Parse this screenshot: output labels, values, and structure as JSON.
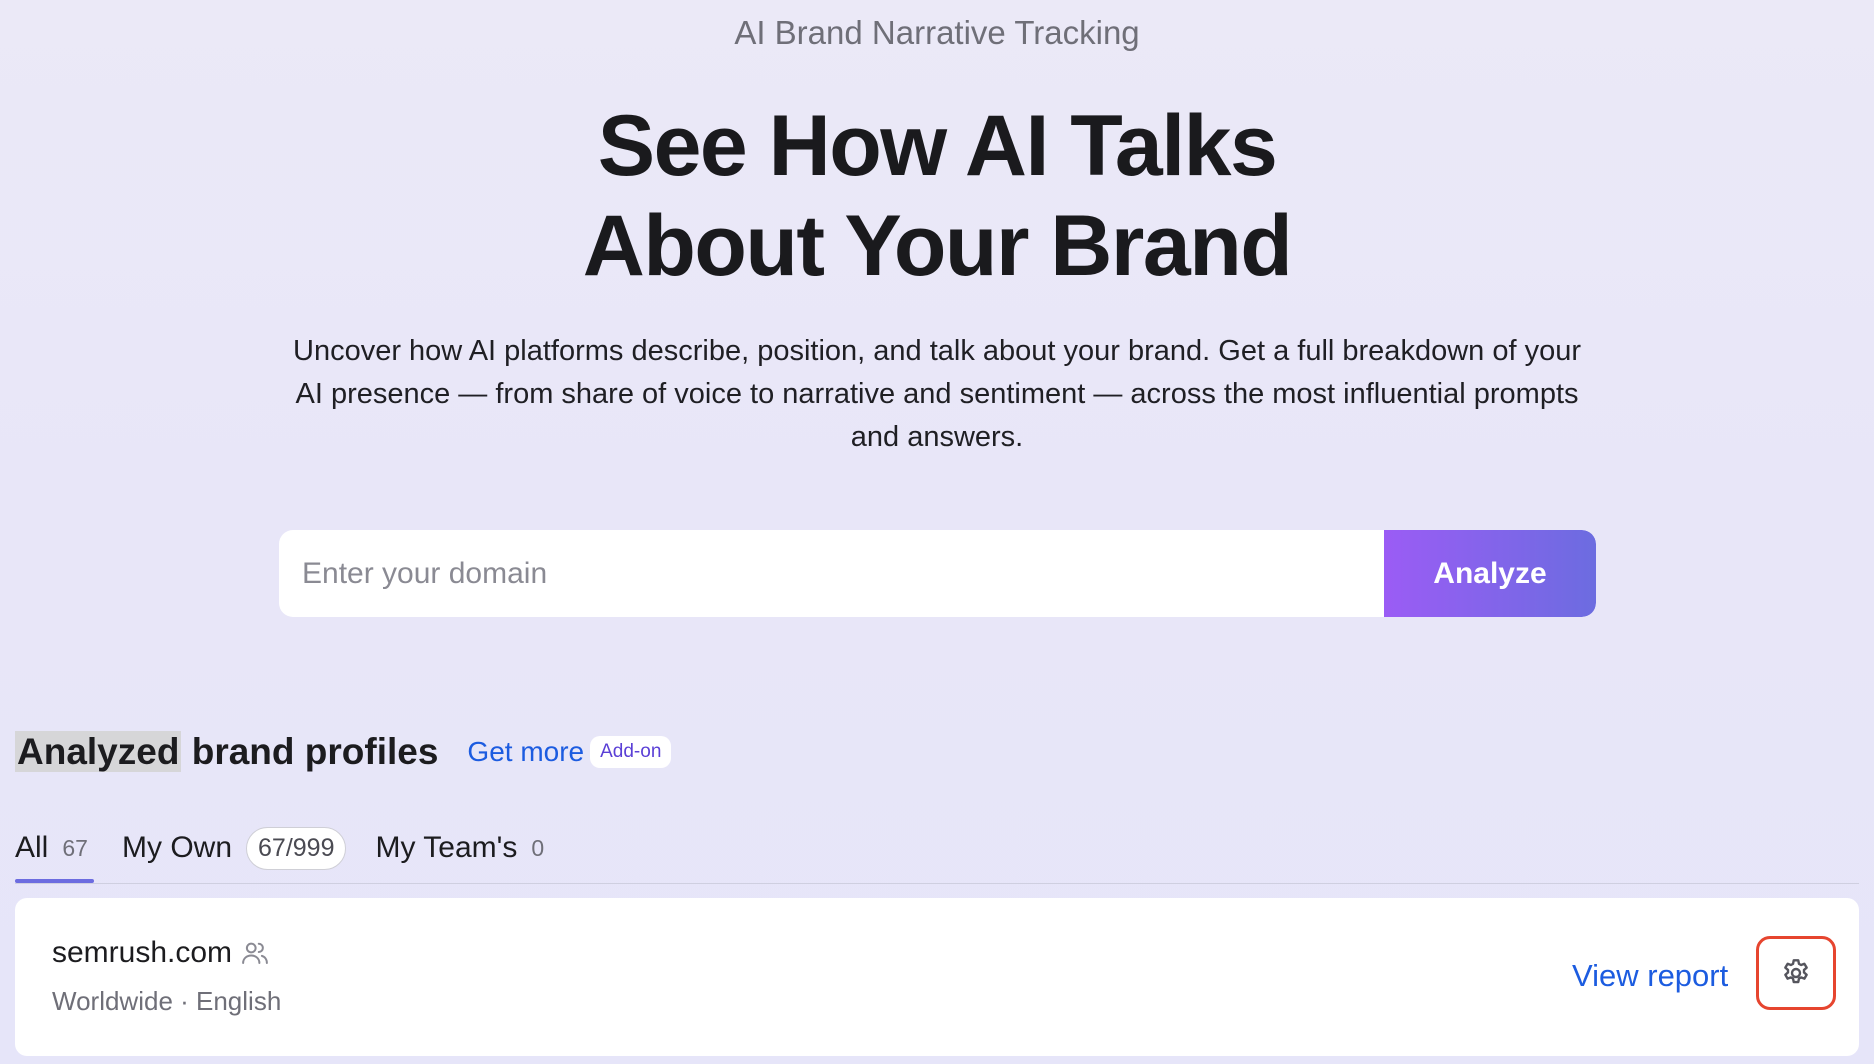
{
  "eyebrow": "AI Brand Narrative Tracking",
  "hero": {
    "title_line1": "See How AI Talks",
    "title_line2": "About Your Brand",
    "description": "Uncover how AI platforms describe, position, and talk about your brand. Get a full breakdown of your AI presence — from share of voice to narrative and sentiment — across the most influential prompts and answers."
  },
  "search": {
    "placeholder": "Enter your domain",
    "value": "",
    "button_label": "Analyze"
  },
  "profiles_section": {
    "title_highlight": "Analyzed",
    "title_rest": " brand profiles",
    "get_more_label": "Get more",
    "addon_badge": "Add-on"
  },
  "tabs": [
    {
      "label": "All",
      "count": "67",
      "active": true
    },
    {
      "label": "My Own",
      "count": "67/999",
      "active": false
    },
    {
      "label": "My Team's",
      "count": "0",
      "active": false
    }
  ],
  "profiles": [
    {
      "domain": "semrush.com",
      "meta": "Worldwide · English",
      "view_report_label": "View report",
      "shared_icon": "team-icon",
      "settings_icon": "gear-icon"
    }
  ],
  "colors": {
    "accent_link": "#1c5ce0",
    "button_gradient_start": "#9b5cf5",
    "button_gradient_end": "#6c6ce0",
    "settings_highlight": "#e6452f"
  }
}
